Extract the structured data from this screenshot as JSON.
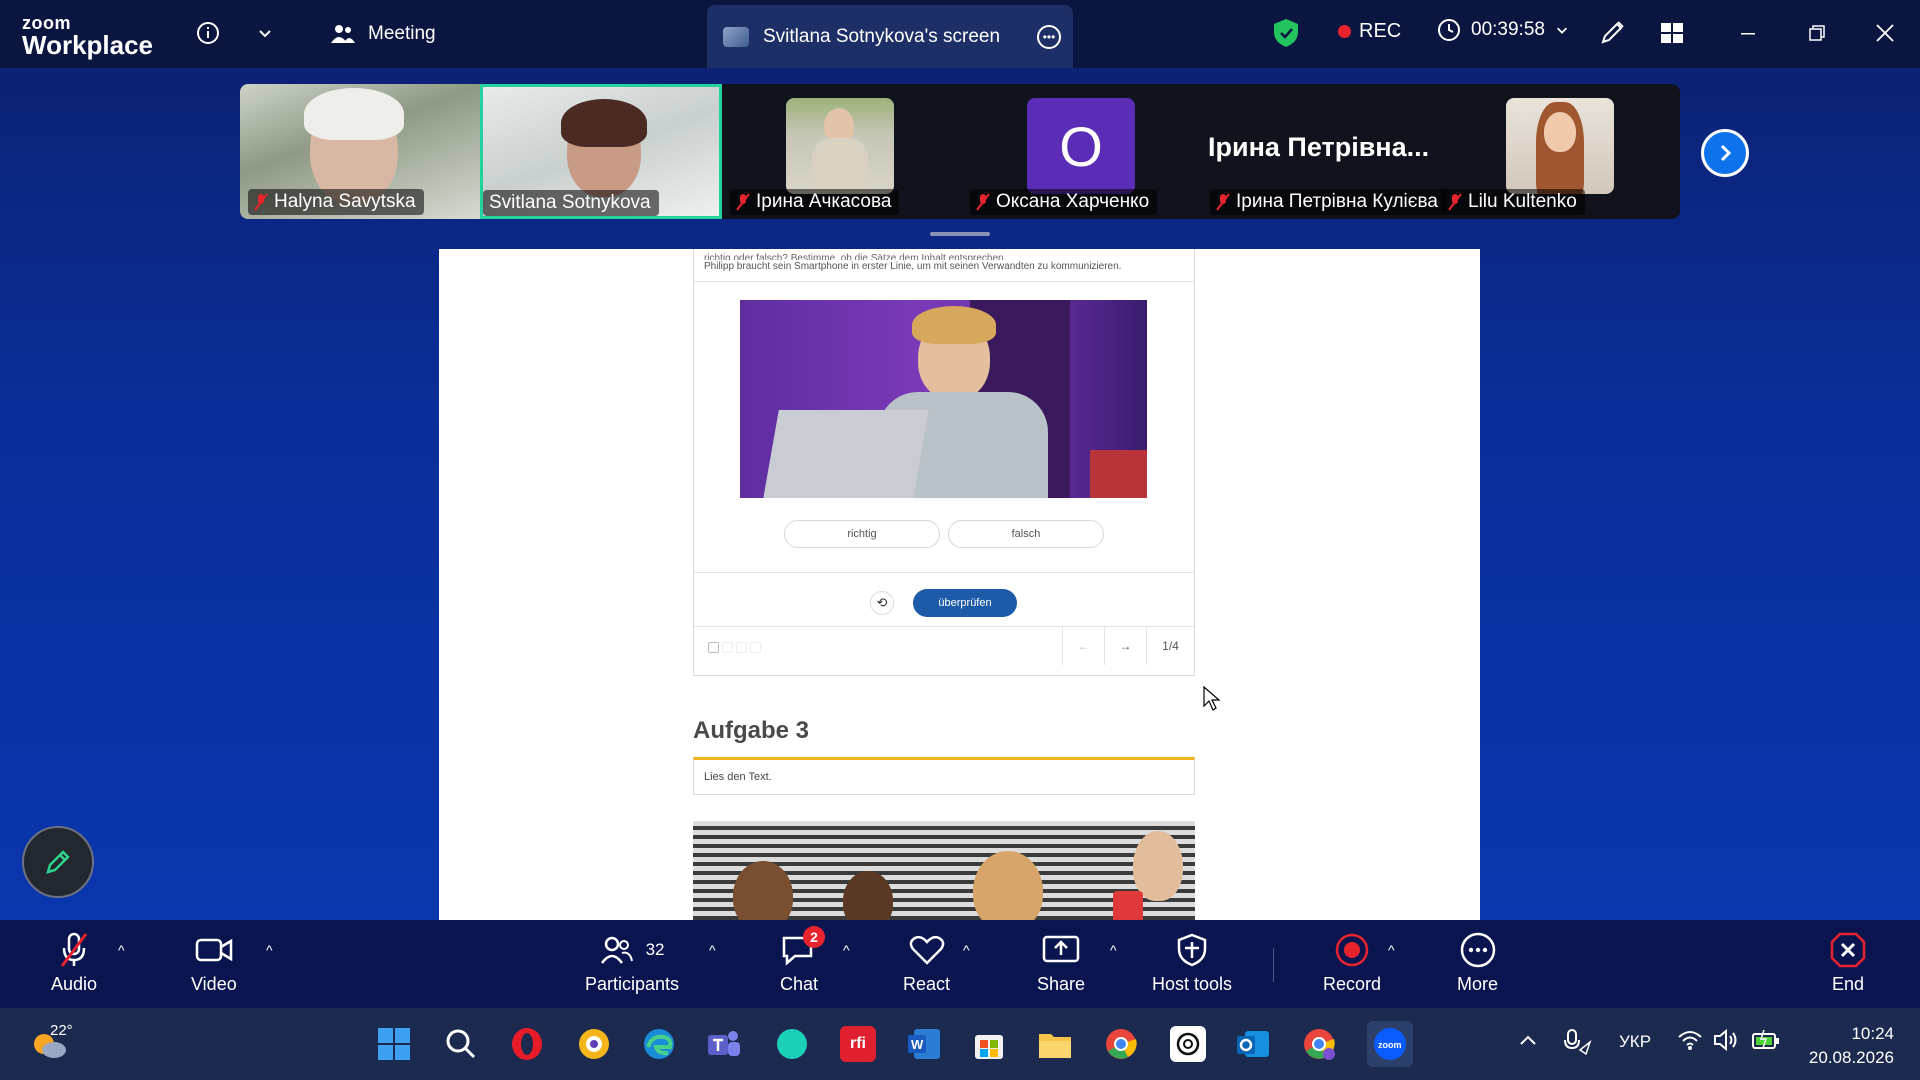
{
  "app": {
    "logo_line1": "zoom",
    "logo_line2": "Workplace"
  },
  "topbar": {
    "meeting_label": "Meeting",
    "shared_tab_label": "Svitlana Sotnykova's screen",
    "rec_label": "REC",
    "timer": "00:39:58",
    "icons": [
      "info-icon",
      "chevron-down-icon",
      "participants-icon",
      "shield-icon",
      "clock-icon",
      "annotate-icon",
      "grid-icon",
      "minimize-icon",
      "restore-icon",
      "close-icon"
    ]
  },
  "participants": [
    {
      "name": "Halyna Savytska",
      "muted": true,
      "type": "video"
    },
    {
      "name": "Svitlana Sotnykova",
      "muted": false,
      "type": "video",
      "active_speaker": true
    },
    {
      "name": "Ірина Ачкасова",
      "muted": true,
      "type": "photo"
    },
    {
      "name": "Оксана Харченко",
      "muted": true,
      "type": "initial",
      "initial": "O"
    },
    {
      "name": "Ірина Петрівна Кулієва",
      "muted": true,
      "type": "name",
      "display_name": "Ірина  Петрівна..."
    },
    {
      "name": "Lilu Kultenko",
      "muted": true,
      "type": "photo"
    }
  ],
  "shared": {
    "header_line0": "richtig oder falsch? Bestimme, ob die Sätze dem Inhalt entsprechen.",
    "header_line1": "Philipp braucht sein Smartphone in erster Linie, um mit seinen Verwandten zu kommunizieren.",
    "answers": [
      "richtig",
      "falsch"
    ],
    "check_label": "überprüfen",
    "page_indicator": "1/4",
    "section_title": "Aufgabe 3",
    "instruction": "Lies den Text."
  },
  "toolbar": {
    "audio": "Audio",
    "video": "Video",
    "participants": "Participants",
    "participants_count": "32",
    "chat": "Chat",
    "chat_badge": "2",
    "react": "React",
    "share": "Share",
    "host_tools": "Host tools",
    "record": "Record",
    "more": "More",
    "end": "End"
  },
  "taskbar": {
    "temperature": "22°",
    "language": "УКР",
    "time": "10:24",
    "date": "20.08.2026",
    "apps": [
      "windows-start",
      "search",
      "opera",
      "vpn",
      "edge",
      "teams",
      "app-teal",
      "rfi",
      "word",
      "store",
      "file-explorer",
      "chrome",
      "chatgpt",
      "outlook",
      "chrome-profile",
      "zoom"
    ]
  },
  "colors": {
    "accent": "#0e72ed",
    "active_speaker": "#22d39e",
    "rec": "#e8232d",
    "check_button": "#1d5ba8",
    "aufgabe_border": "#f0b31a"
  }
}
